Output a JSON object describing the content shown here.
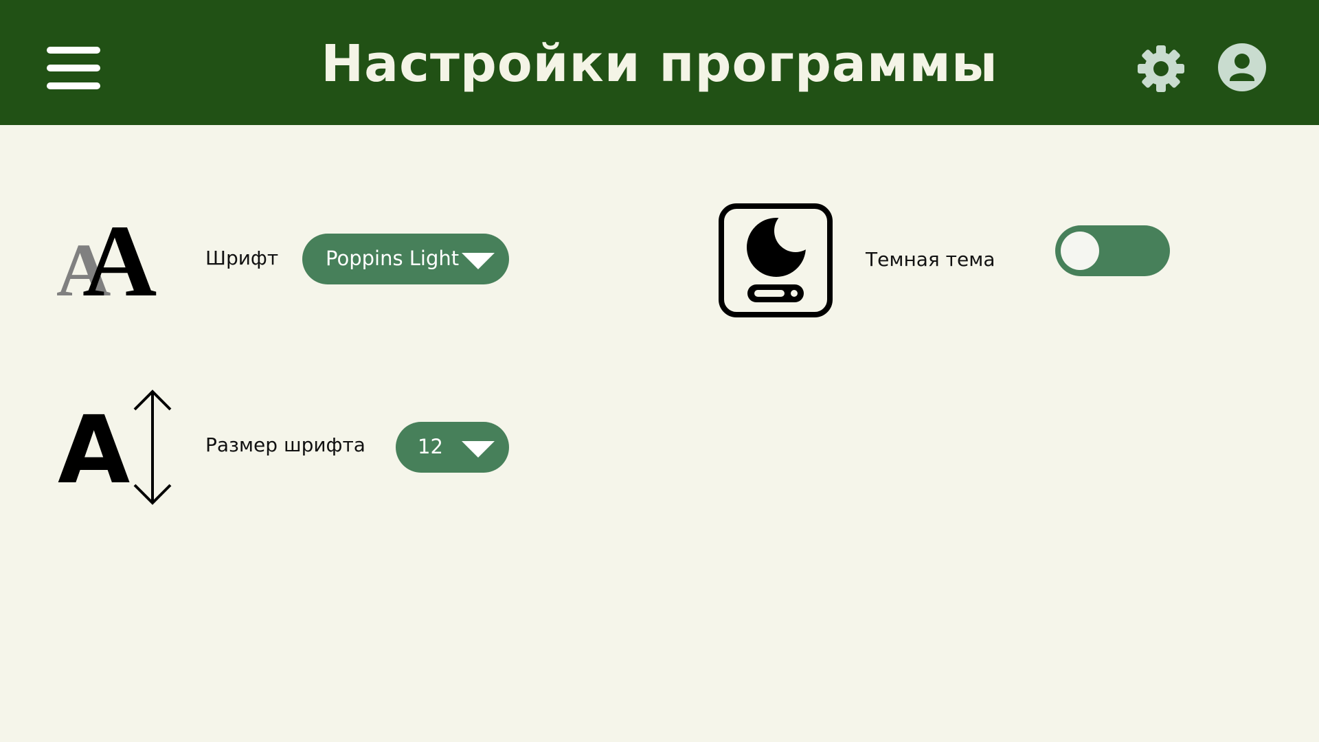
{
  "header": {
    "title": "Настройки программы",
    "menu_icon": "hamburger-menu-icon",
    "settings_icon": "gear-icon",
    "profile_icon": "user-profile-icon"
  },
  "settings": {
    "font": {
      "label": "Шрифт",
      "value": "Poppins Light",
      "icon": "font-family-icon"
    },
    "font_size": {
      "label": "Размер шрифта",
      "value": "12",
      "icon": "font-size-icon"
    },
    "dark_theme": {
      "label": "Темная тема",
      "enabled": false,
      "icon": "dark-mode-icon"
    }
  },
  "colors": {
    "header_bg": "#215115",
    "page_bg": "#f5f5ea",
    "accent": "#47805a",
    "title_text": "#f4f4e6"
  }
}
